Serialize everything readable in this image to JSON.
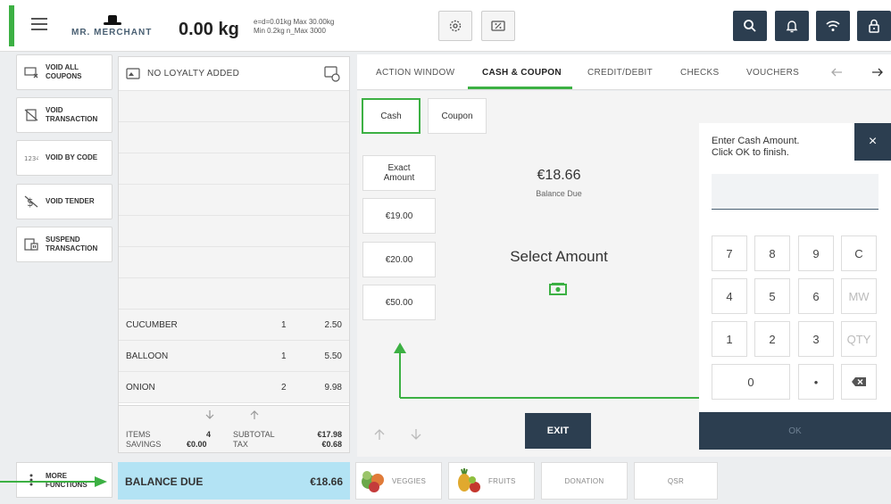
{
  "header": {
    "brand": "MR. MERCHANT",
    "weight": "0.00 kg",
    "scale_line1": "e=d=0.01kg Max 30.00kg",
    "scale_line2": "Min 0.2kg n_Max 3000",
    "icons": [
      "menu-icon",
      "settings-icon",
      "discount-icon",
      "search-icon",
      "bell-icon",
      "wifi-icon",
      "lock-icon"
    ]
  },
  "sidebar": {
    "items": [
      {
        "label": "VOID ALL COUPONS",
        "icon": "coupon-void-icon"
      },
      {
        "label": "VOID TRANSACTION",
        "icon": "transaction-void-icon"
      },
      {
        "label": "VOID BY CODE",
        "icon": "code-icon"
      },
      {
        "label": "VOID TENDER",
        "icon": "tender-void-icon"
      },
      {
        "label": "SUSPEND TRANSACTION",
        "icon": "suspend-icon"
      }
    ],
    "more": "MORE FUNCTIONS"
  },
  "receipt": {
    "loyalty": "NO LOYALTY ADDED",
    "items": [
      {
        "name": "CUCUMBER",
        "qty": "1",
        "price": "2.50"
      },
      {
        "name": "BALLOON",
        "qty": "1",
        "price": "5.50"
      },
      {
        "name": "ONION",
        "qty": "2",
        "price": "9.98"
      }
    ],
    "totals": {
      "items_label": "ITEMS",
      "items_value": "4",
      "savings_label": "SAVINGS",
      "savings_value": "€0.00",
      "subtotal_label": "SUBTOTAL",
      "subtotal_value": "€17.98",
      "tax_label": "TAX",
      "tax_value": "€0.68"
    },
    "balance_label": "BALANCE DUE",
    "balance_value": "€18.66"
  },
  "tabs": [
    "ACTION WINDOW",
    "CASH & COUPON",
    "CREDIT/DEBIT",
    "CHECKS",
    "VOUCHERS"
  ],
  "active_tab": "CASH & COUPON",
  "payment": {
    "modes": [
      "Cash",
      "Coupon"
    ],
    "selected_mode": "Cash",
    "quick_amounts": [
      "Exact Amount",
      "€19.00",
      "€20.00",
      "€50.00"
    ],
    "amount": "€18.66",
    "amount_caption": "Balance Due",
    "select_amount": "Select Amount",
    "exit": "EXIT"
  },
  "keypad": {
    "prompt": "Enter Cash Amount.\nClick OK to finish.",
    "close": "×",
    "input_value": "",
    "keys": [
      "7",
      "8",
      "9",
      "C",
      "4",
      "5",
      "6",
      "MW",
      "1",
      "2",
      "3",
      "QTY",
      "0",
      "•"
    ],
    "ok": "OK"
  },
  "categories": [
    "VEGGIES",
    "FRUITS",
    "DONATION",
    "QSR"
  ],
  "colors": {
    "accent": "#3cb043",
    "dark": "#2c3e50",
    "balance_bg": "#b3e3f4"
  }
}
